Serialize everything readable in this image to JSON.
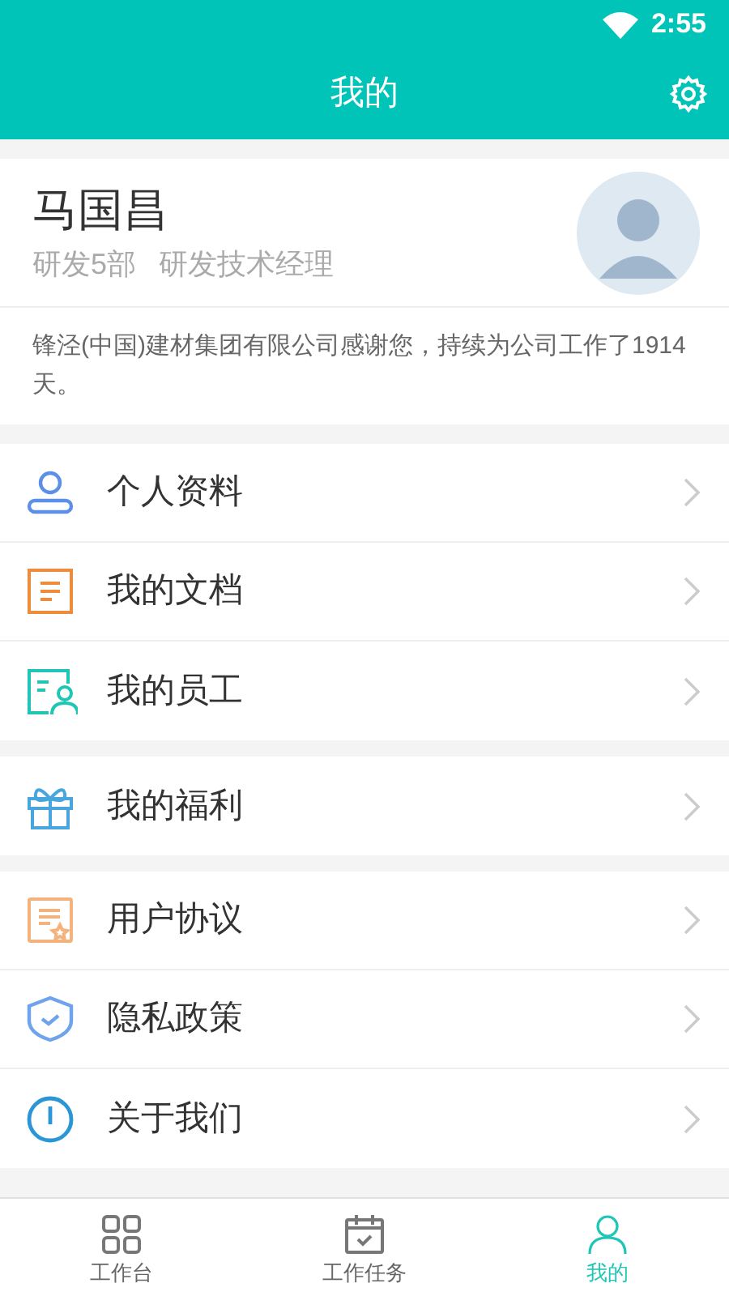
{
  "status_bar": {
    "time": "2:55"
  },
  "header": {
    "title": "我的"
  },
  "profile": {
    "name": "马国昌",
    "department": "研发5部",
    "position": "研发技术经理",
    "message": "锋泾(中国)建材集团有限公司感谢您，持续为公司工作了1914天。"
  },
  "menu_groups": [
    [
      {
        "kind": "person",
        "label": "个人资料"
      },
      {
        "kind": "document",
        "label": "我的文档"
      },
      {
        "kind": "staff",
        "label": "我的员工"
      }
    ],
    [
      {
        "kind": "gift",
        "label": "我的福利"
      }
    ],
    [
      {
        "kind": "agreement",
        "label": "用户协议"
      },
      {
        "kind": "shield",
        "label": "隐私政策"
      },
      {
        "kind": "info",
        "label": "关于我们"
      }
    ]
  ],
  "tab_bar": [
    {
      "kind": "grid",
      "label": "工作台",
      "selected": false
    },
    {
      "kind": "calendar",
      "label": "工作任务",
      "selected": false
    },
    {
      "kind": "person",
      "label": "我的",
      "selected": true
    }
  ]
}
